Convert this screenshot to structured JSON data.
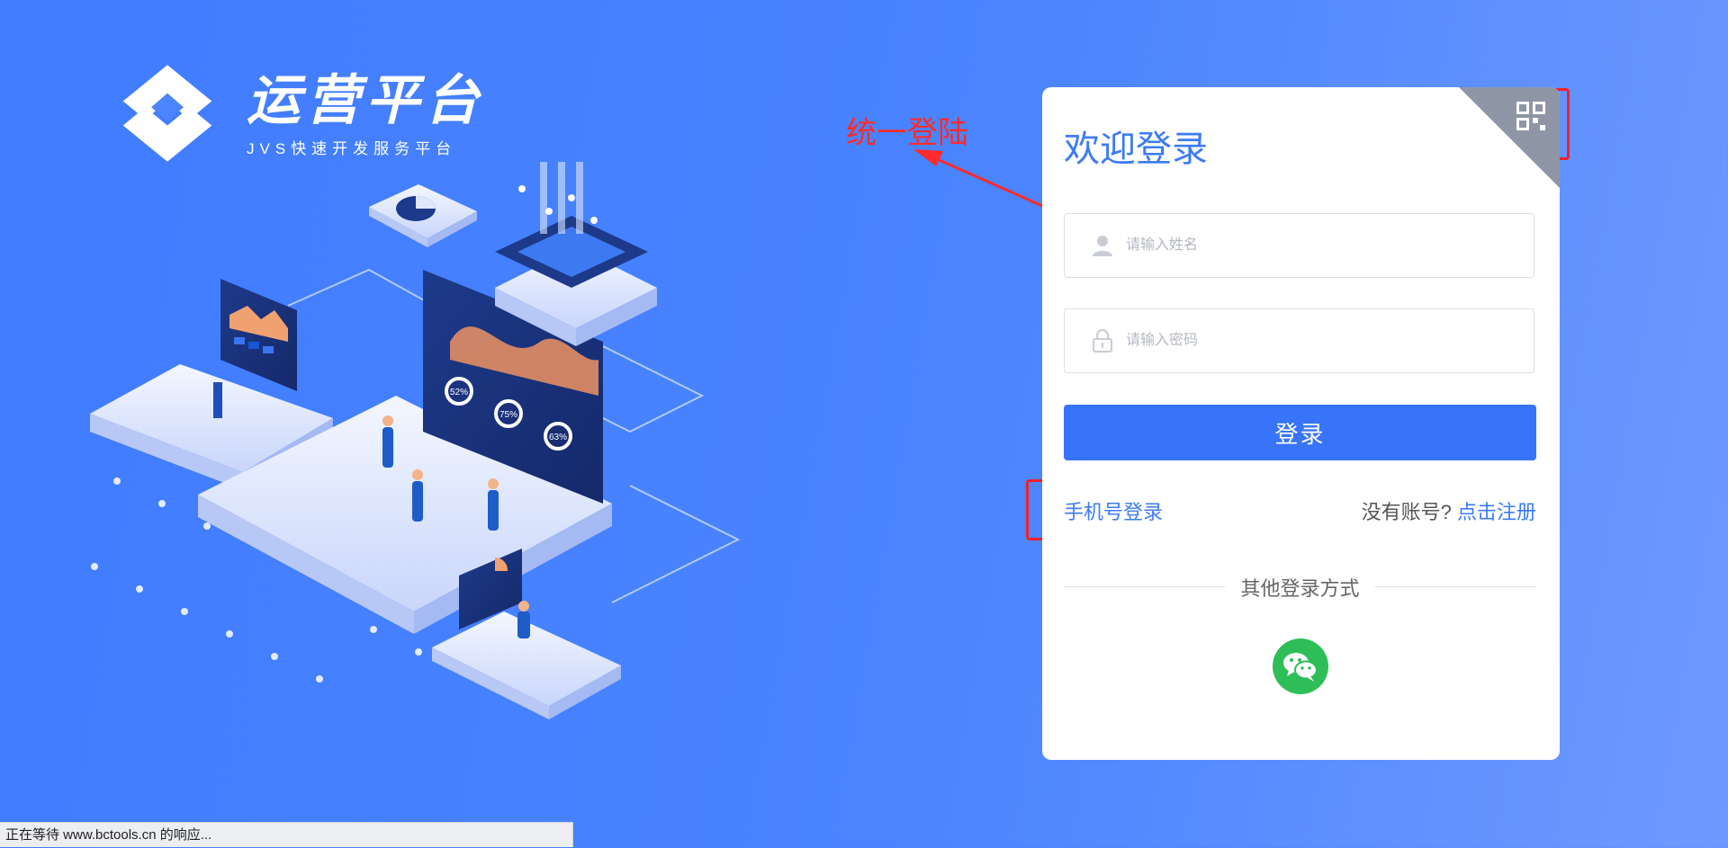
{
  "brand": {
    "title": "运营平台",
    "subtitle": "JVS快速开发服务平台"
  },
  "annotation": {
    "label": "统一登陆",
    "color": "#ff2a2a"
  },
  "login": {
    "welcome": "欢迎登录",
    "username_placeholder": "请输入姓名",
    "password_placeholder": "请输入密码",
    "login_button": "登录",
    "phone_login": "手机号登录",
    "no_account": "没有账号?",
    "register_link": "点击注册",
    "other_methods": "其他登录方式",
    "qr_icon": "qr-code-icon",
    "wechat_icon": "wechat-icon"
  },
  "illustration_labels": {
    "pct1": "52%",
    "pct2": "75%",
    "pct3": "63%"
  },
  "status_bar": {
    "text": "正在等待 www.bctools.cn 的响应..."
  },
  "colors": {
    "accent": "#3874f9",
    "background": "#4a84ff",
    "wechat": "#2fbd58",
    "annotation": "#f2202a"
  }
}
